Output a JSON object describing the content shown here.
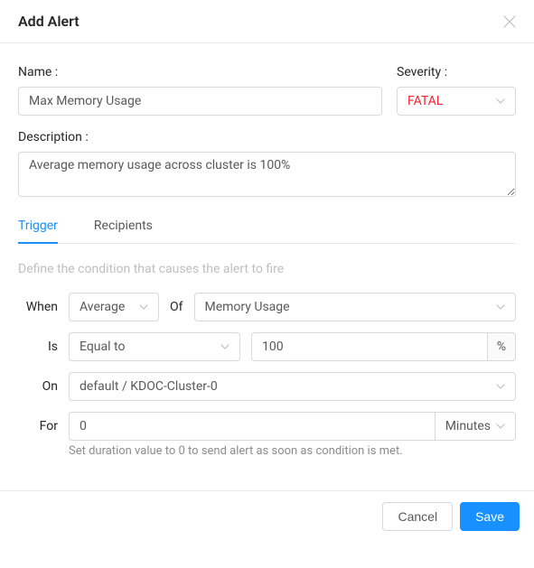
{
  "header": {
    "title": "Add Alert"
  },
  "labels": {
    "name": "Name :",
    "severity": "Severity :",
    "description": "Description :"
  },
  "fields": {
    "name_value": "Max Memory Usage",
    "severity_value": "FATAL",
    "description_value": "Average memory usage across cluster is 100%"
  },
  "tabs": {
    "trigger": "Trigger",
    "recipients": "Recipients"
  },
  "trigger": {
    "hint": "Define the condition that causes the alert to fire",
    "when_label": "When",
    "agg_value": "Average",
    "of_label": "Of",
    "metric_value": "Memory Usage",
    "is_label": "Is",
    "op_value": "Equal to",
    "threshold_value": "100",
    "threshold_unit": "%",
    "on_label": "On",
    "target_value": "default / KDOC-Cluster-0",
    "for_label": "For",
    "duration_value": "0",
    "duration_unit": "Minutes",
    "duration_hint": "Set duration value to 0 to send alert as soon as condition is met."
  },
  "footer": {
    "cancel": "Cancel",
    "save": "Save"
  }
}
